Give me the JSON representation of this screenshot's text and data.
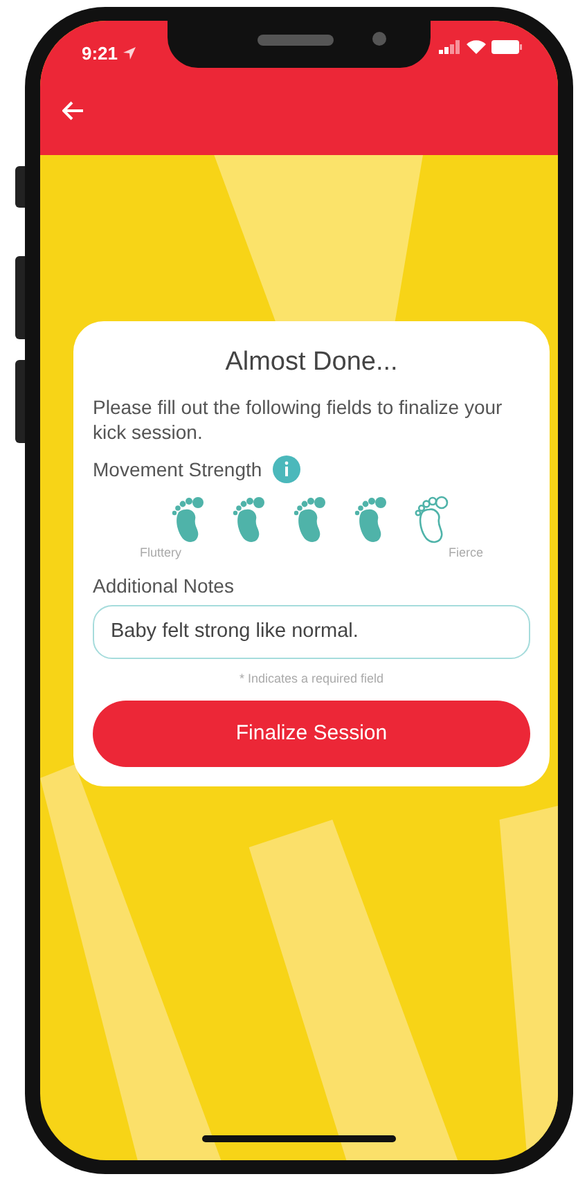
{
  "status_bar": {
    "time": "9:21"
  },
  "card": {
    "title": "Almost Done...",
    "intro": "Please fill out the following fields to finalize your kick session.",
    "strength": {
      "label": "Movement Strength",
      "stars": 4,
      "min_label": "Fluttery",
      "max_label": "Fierce"
    },
    "notes": {
      "label": "Additional Notes",
      "value": "Baby felt strong like normal."
    },
    "required_note": "* Indicates a required field",
    "button": "Finalize Session"
  }
}
